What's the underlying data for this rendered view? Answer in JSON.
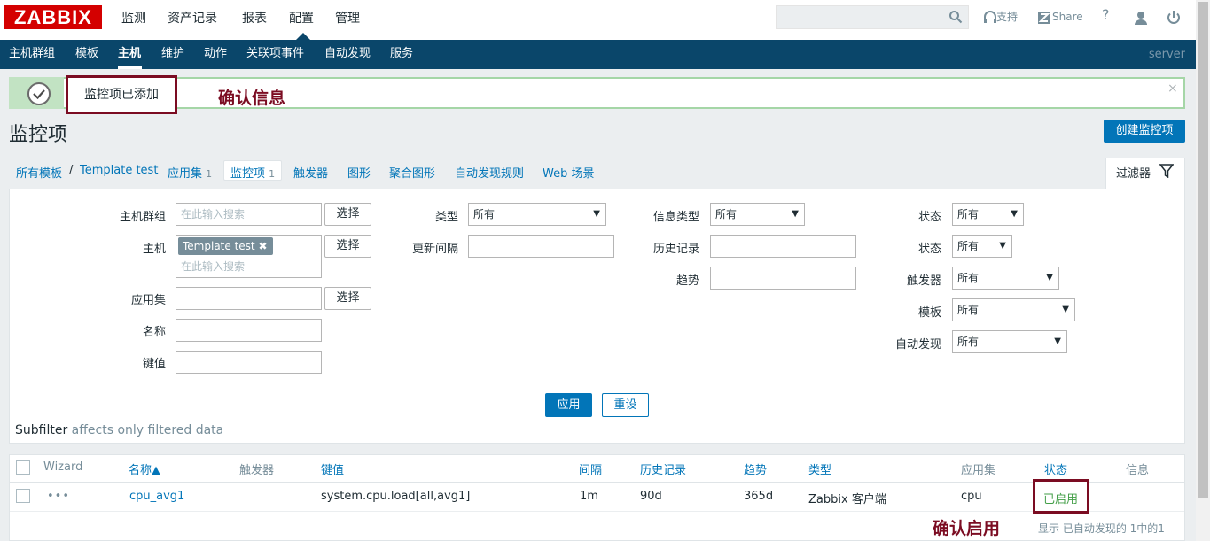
{
  "logo": "ZABBIX",
  "main_menu": [
    "监测",
    "资产记录",
    "报表",
    "配置",
    "管理"
  ],
  "topbar": {
    "support": "支持",
    "share": "Share",
    "help": "?"
  },
  "sub_menu": [
    "主机群组",
    "模板",
    "主机",
    "维护",
    "动作",
    "关联项事件",
    "自动发现",
    "服务"
  ],
  "server": "server",
  "message": {
    "text": "监控项已添加",
    "annotation": "确认信息",
    "close": "×"
  },
  "page_title": "监控项",
  "create_button": "创建监控项",
  "nav": {
    "all_templates": "所有模板",
    "separator": "/",
    "template": "Template test",
    "applications": "应用集",
    "applications_count": "1",
    "items": "监控项",
    "items_count": "1",
    "triggers": "触发器",
    "graphs": "图形",
    "screens": "聚合图形",
    "discovery": "自动发现规则",
    "web": "Web 场景"
  },
  "filter_tab": "过滤器",
  "filter": {
    "host_group_label": "主机群组",
    "host_label": "主机",
    "app_label": "应用集",
    "name_label": "名称",
    "key_label": "键值",
    "search_placeholder": "在此输入搜索",
    "select_button": "选择",
    "host_chip": "Template test",
    "type_label": "类型",
    "interval_label": "更新间隔",
    "info_type_label": "信息类型",
    "history_label": "历史记录",
    "trend_label": "趋势",
    "status_label": "状态",
    "state_label": "状态",
    "triggers_label": "触发器",
    "template_label": "模板",
    "discovery_label": "自动发现",
    "all": "所有",
    "apply": "应用",
    "reset": "重设"
  },
  "subfilter": {
    "title": "Subfilter",
    "note": "affects only filtered data"
  },
  "table": {
    "headers": {
      "wizard": "Wizard",
      "name": "名称▲",
      "triggers": "触发器",
      "key": "键值",
      "interval": "间隔",
      "history": "历史记录",
      "trends": "趋势",
      "type": "类型",
      "applications": "应用集",
      "status": "状态",
      "info": "信息"
    },
    "rows": [
      {
        "wizard": "•••",
        "name": "cpu_avg1",
        "key": "system.cpu.load[all,avg1]",
        "interval": "1m",
        "history": "90d",
        "trends": "365d",
        "type": "Zabbix 客户端",
        "applications": "cpu",
        "status": "已启用"
      }
    ]
  },
  "status_annotation": "确认启用",
  "footer": "显示 已自动发现的 1中的1"
}
